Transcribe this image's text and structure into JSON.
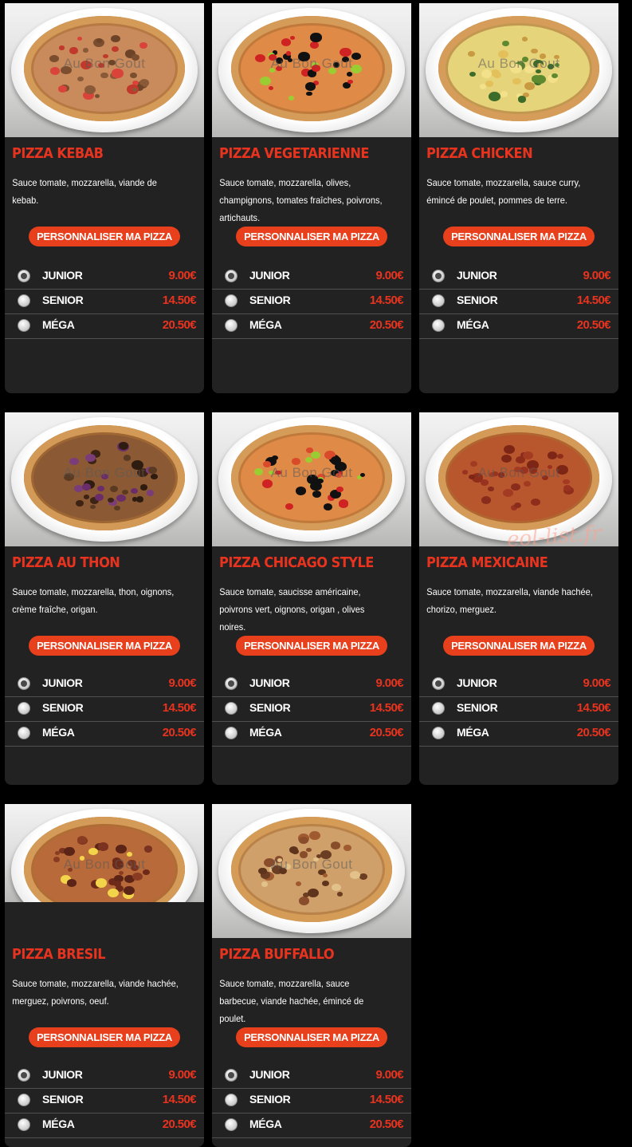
{
  "watermark": "Au Bon Gout",
  "site_watermark": "eol-list.fr",
  "button_label": "PERSONNALISER MA PIZZA",
  "colors": {
    "accent": "#e8331f",
    "button": "#e8401c",
    "card": "#222222",
    "background": "#000000"
  },
  "sizes": [
    {
      "label": "JUNIOR",
      "selected": true
    },
    {
      "label": "SENIOR",
      "selected": false
    },
    {
      "label": "MÉGA",
      "selected": false
    }
  ],
  "pizzas": [
    {
      "title": "PIZZA KEBAB",
      "description": "Sauce tomate, mozzarella, viande de kebab.",
      "prices": [
        "9.00€",
        "14.50€",
        "20.50€"
      ]
    },
    {
      "title": "PIZZA VEGETARIENNE",
      "description": "Sauce tomate, mozzarella, olives, champignons, tomates fraîches, poivrons, artichauts.",
      "prices": [
        "9.00€",
        "14.50€",
        "20.50€"
      ]
    },
    {
      "title": "PIZZA CHICKEN",
      "description": "Sauce tomate, mozzarella, sauce curry, émincé de poulet, pommes de terre.",
      "prices": [
        "9.00€",
        "14.50€",
        "20.50€"
      ]
    },
    {
      "title": "PIZZA AU THON",
      "description": "Sauce tomate, mozzarella, thon, oignons, crème fraîche, origan.",
      "prices": [
        "9.00€",
        "14.50€",
        "20.50€"
      ]
    },
    {
      "title": "PIZZA CHICAGO STYLE",
      "description": "Sauce tomate, saucisse américaine, poivrons vert, oignons, origan , olives noires.",
      "prices": [
        "9.00€",
        "14.50€",
        "20.50€"
      ]
    },
    {
      "title": "PIZZA MEXICAINE",
      "description": "Sauce tomate, mozzarella, viande hachée, chorizo, merguez.",
      "prices": [
        "9.00€",
        "14.50€",
        "20.50€"
      ]
    },
    {
      "title": "PIZZA BRESIL",
      "description": "Sauce tomate, mozzarella, viande hachée, merguez, poivrons, oeuf.",
      "prices": [
        "9.00€",
        "14.50€",
        "20.50€"
      ]
    },
    {
      "title": "PIZZA BUFFALLO",
      "description": "Sauce tomate, mozzarella, sauce barbecue, viande hachée, émincé de poulet.",
      "prices": [
        "9.00€",
        "14.50€",
        "20.50€"
      ]
    }
  ]
}
